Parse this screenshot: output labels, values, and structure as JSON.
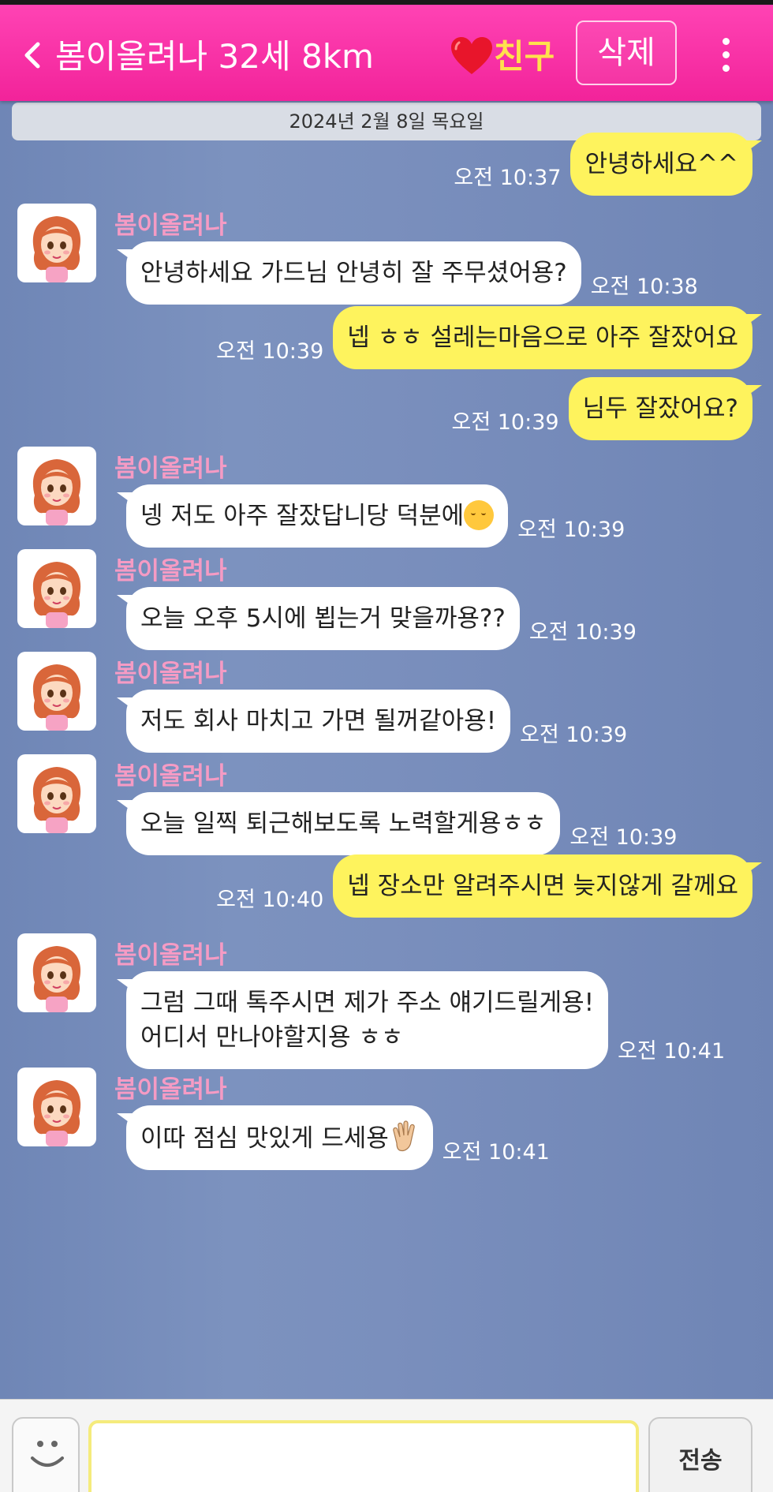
{
  "header": {
    "title": "봄이올려나 32세 8km",
    "friend_label": "친구",
    "delete_label": "삭제",
    "back_icon": "chevron-left-icon",
    "heart_icon": "heart-icon",
    "more_icon": "more-vertical-icon",
    "bg_color": "#f52a9f",
    "friend_color": "#ffe14d",
    "heart_color": "#e8152b"
  },
  "chat": {
    "date": "2024년 2월 8일 목요일",
    "sender_name": "봄이올려나",
    "bg_color": "#7a8fbd",
    "out_bubble_color": "#fef35d",
    "in_bubble_color": "#ffffff",
    "messages": [
      {
        "direction": "out",
        "text": "안녕하세요^^",
        "time": "오전 10:37"
      },
      {
        "direction": "in",
        "sender": "봄이올려나",
        "text": "안녕하세요 가드님 안녕히 잘 주무셨어용?",
        "time": "오전 10:38"
      },
      {
        "direction": "out",
        "text": "넵 ㅎㅎ 설레는마음으로 아주 잘잤어요",
        "time": "오전 10:39"
      },
      {
        "direction": "out",
        "text": "님두 잘잤어요?",
        "time": "오전 10:39"
      },
      {
        "direction": "in",
        "sender": "봄이올려나",
        "text": "넹 저도 아주 잘잤답니당 덕분에",
        "emoji": "shush-face-emoji",
        "time": "오전 10:39"
      },
      {
        "direction": "in",
        "sender": "봄이올려나",
        "text": "오늘 오후 5시에 뵙는거 맞을까용??",
        "time": "오전 10:39"
      },
      {
        "direction": "in",
        "sender": "봄이올려나",
        "text": "저도 회사 마치고 가면 될꺼같아용!",
        "time": "오전 10:39"
      },
      {
        "direction": "in",
        "sender": "봄이올려나",
        "text": "오늘 일찍 퇴근해보도록 노력할게용ㅎㅎ",
        "time": "오전 10:39"
      },
      {
        "direction": "out",
        "text": "넵 장소만 알려주시면 늦지않게 갈께요",
        "time": "오전 10:40"
      },
      {
        "direction": "in",
        "sender": "봄이올려나",
        "text": "그럼 그때 톡주시면 제가 주소 얘기드릴게용!\n어디서 만나야할지용 ㅎㅎ",
        "time": "오전 10:41"
      },
      {
        "direction": "in",
        "sender": "봄이올려나",
        "text": "이따 점심 맛있게 드세용",
        "emoji": "waving-hand-emoji",
        "time": "오전 10:41"
      }
    ]
  },
  "input": {
    "value": "",
    "send_label": "전송",
    "emoji_button_icon": "smiley-icon"
  }
}
